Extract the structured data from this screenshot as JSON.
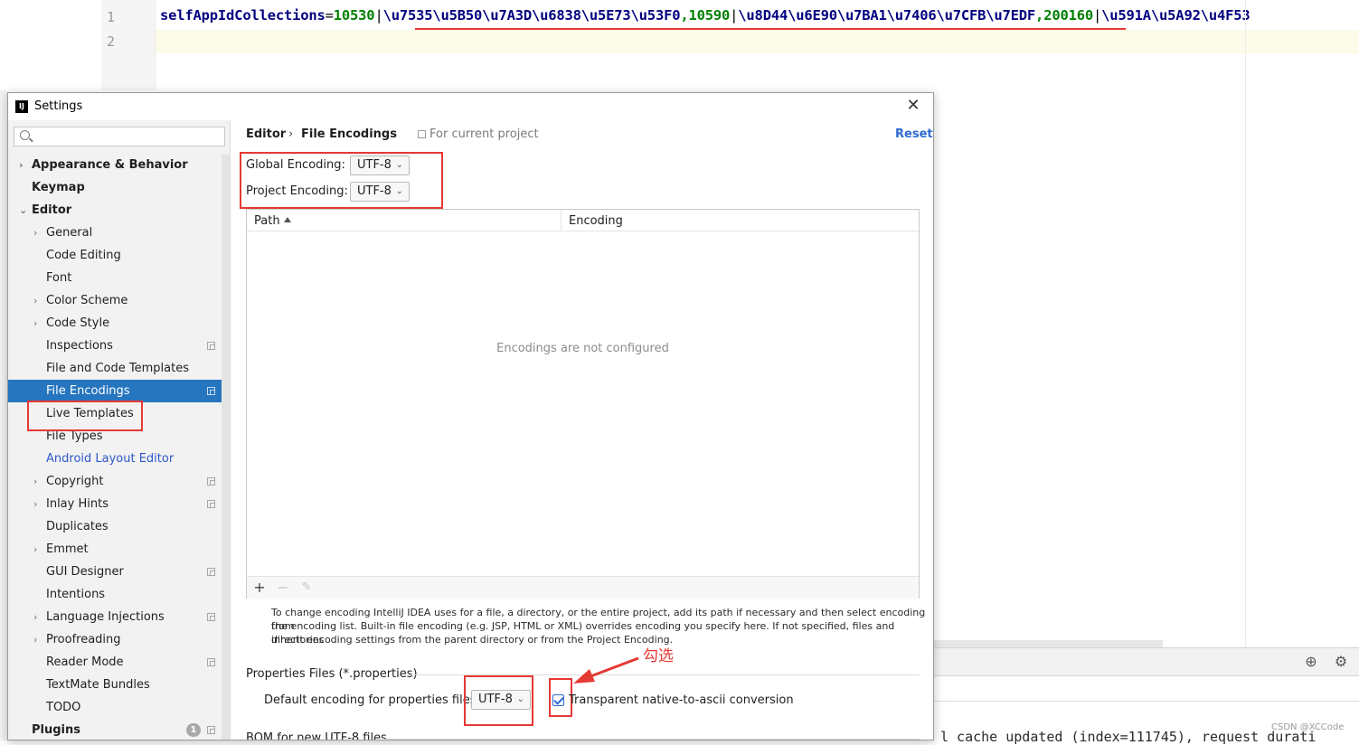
{
  "editor": {
    "line_numbers": [
      "1",
      "2"
    ],
    "code": {
      "key": "selfAppIdCollections",
      "eq": "=",
      "num1": "10530",
      "sep1": "|",
      "esc1": "\\u7535\\u5B50\\u7A3D\\u6838\\u5E73\\u53F0",
      "comma1": ",",
      "num2": "10590",
      "sep2": "|",
      "esc2": "\\u8D44\\u6E90\\u7BA1\\u7406\\u7CFB\\u7EDF",
      "comma2": ",",
      "num3": "200160",
      "sep3": "|",
      "esc3": "\\u591A\\u5A92\\u4F53"
    }
  },
  "console": {
    "text": "l cache updated (index=111745), request durati",
    "watermark": "CSDN @XCCode"
  },
  "dialog": {
    "title": "Settings",
    "app_icon": "IJ",
    "close_label": "✕"
  },
  "search": {
    "placeholder": "",
    "value": ""
  },
  "tree": [
    {
      "label": "Appearance & Behavior",
      "chevron": "›"
    },
    {
      "label": "Keymap"
    },
    {
      "label": "Editor",
      "chevron": "⌄"
    },
    {
      "label": "General",
      "chevron": "›"
    },
    {
      "label": "Code Editing"
    },
    {
      "label": "Font"
    },
    {
      "label": "Color Scheme",
      "chevron": "›"
    },
    {
      "label": "Code Style",
      "chevron": "›"
    },
    {
      "label": "Inspections"
    },
    {
      "label": "File and Code Templates"
    },
    {
      "label": "File Encodings"
    },
    {
      "label": "Live Templates"
    },
    {
      "label": "File Types"
    },
    {
      "label": "Android Layout Editor"
    },
    {
      "label": "Copyright",
      "chevron": "›"
    },
    {
      "label": "Inlay Hints",
      "chevron": "›"
    },
    {
      "label": "Duplicates"
    },
    {
      "label": "Emmet",
      "chevron": "›"
    },
    {
      "label": "GUI Designer"
    },
    {
      "label": "Intentions"
    },
    {
      "label": "Language Injections",
      "chevron": "›"
    },
    {
      "label": "Proofreading",
      "chevron": "›"
    },
    {
      "label": "Reader Mode"
    },
    {
      "label": "TextMate Bundles"
    },
    {
      "label": "TODO"
    },
    {
      "label": "Plugins",
      "badge": "1"
    }
  ],
  "breadcrumb": {
    "section": "Editor",
    "separator": "›",
    "page": "File Encodings",
    "scope": "For current project"
  },
  "reset_label": "Reset",
  "encodings": {
    "global_label": "Global Encoding:",
    "global_value": "UTF-8",
    "project_label": "Project Encoding:",
    "project_value": "UTF-8"
  },
  "table": {
    "col_path": "Path",
    "col_encoding": "Encoding",
    "empty_text": "Encodings are not configured",
    "add": "+",
    "remove": "−",
    "edit": "✎"
  },
  "help": [
    "To change encoding IntelliJ IDEA uses for a file, a directory, or the entire project, add its path if necessary and then select encoding from",
    "the encoding list. Built-in file encoding (e.g. JSP, HTML or XML) overrides encoding you specify here. If not specified, files and directories",
    "inherit encoding settings from the parent directory or from the Project Encoding."
  ],
  "properties": {
    "title": "Properties Files (*.properties)",
    "default_label": "Default encoding for properties files:",
    "default_value": "UTF-8",
    "native_label": "Transparent native-to-ascii conversion",
    "native_checked": true
  },
  "bom_title": "BOM for new UTF-8 files",
  "annotation": {
    "text": "勾选",
    "color": "#e53935"
  },
  "colors": {
    "selection": "#2675bf",
    "link": "#2e57c9",
    "annotation": "#e53935",
    "code_number": "#008000",
    "code_key": "#000080"
  }
}
